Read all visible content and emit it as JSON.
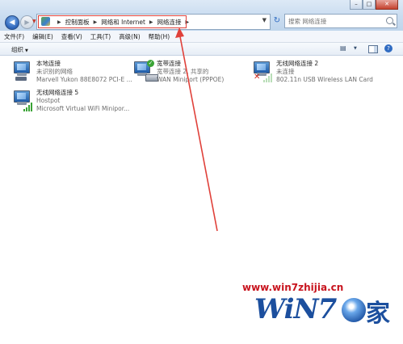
{
  "address_bar": {
    "crumbs": [
      "控制面板",
      "网络和 Internet",
      "网络连接"
    ]
  },
  "search": {
    "placeholder": "搜索 网络连接"
  },
  "menu": [
    "文件(F)",
    "编辑(E)",
    "查看(V)",
    "工具(T)",
    "高级(N)",
    "帮助(H)"
  ],
  "toolbar": {
    "organize_label": "组织"
  },
  "connections": [
    {
      "name": "本地连接",
      "status": "未识别的网络",
      "device": "Marvell Yukon 88E8072 PCI-E ...",
      "icon": "ethernet-adapter-icon"
    },
    {
      "name": "宽带连接",
      "status": "宽带连接 2, 共享的",
      "device": "WAN Miniport (PPPOE)",
      "icon": "broadband-modem-icon"
    },
    {
      "name": "无线网络连接 2",
      "status": "未连接",
      "device": "802.11n USB Wireless LAN Card",
      "icon": "wireless-disconnected-icon"
    },
    {
      "name": "无线网络连接 5",
      "status": "Hostpot",
      "device": "Microsoft Virtual WiFi Minipor...",
      "icon": "wireless-connected-icon"
    }
  ],
  "watermark": {
    "url": "www.win7zhijia.cn",
    "logo_text": "WiN7",
    "logo_char": "家"
  },
  "colors": {
    "highlight": "#e0413a",
    "watermark_red": "#c8141e",
    "watermark_blue": "#1c4f9e"
  }
}
